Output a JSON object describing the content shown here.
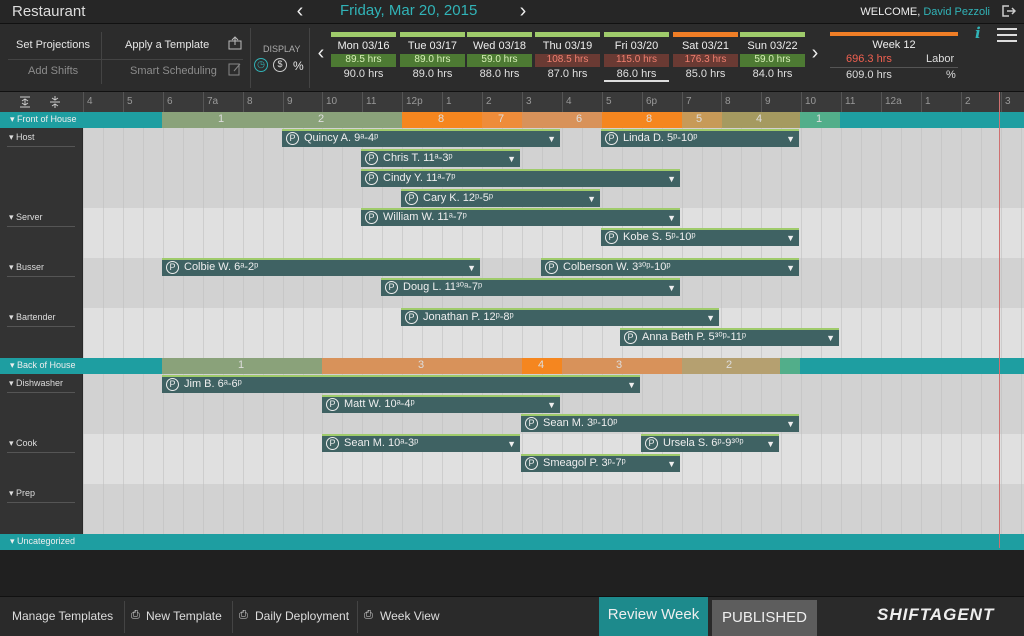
{
  "app_title": "Restaurant",
  "date_title": "Friday, Mar 20, 2015",
  "welcome": {
    "prefix": "WELCOME,",
    "user": "David Pezzoli"
  },
  "toolbar": {
    "set_projections": "Set Projections",
    "apply_template": "Apply a Template",
    "add_shifts": "Add Shifts",
    "smart_scheduling": "Smart Scheduling",
    "display_label": "DISPLAY",
    "percent_symbol": "%"
  },
  "days": [
    {
      "label": "Mon 03/16",
      "hours": "89.5 hrs",
      "scheduled": "90.0 hrs",
      "status": "ok"
    },
    {
      "label": "Tue 03/17",
      "hours": "89.0 hrs",
      "scheduled": "89.0 hrs",
      "status": "ok"
    },
    {
      "label": "Wed 03/18",
      "hours": "59.0 hrs",
      "scheduled": "88.0 hrs",
      "status": "ok"
    },
    {
      "label": "Thu 03/19",
      "hours": "108.5 hrs",
      "scheduled": "87.0 hrs",
      "status": "over"
    },
    {
      "label": "Fri 03/20",
      "hours": "115.0 hrs",
      "scheduled": "86.0 hrs",
      "status": "over"
    },
    {
      "label": "Sat 03/21",
      "hours": "176.3 hrs",
      "scheduled": "85.0 hrs",
      "status": "over"
    },
    {
      "label": "Sun 03/22",
      "hours": "59.0 hrs",
      "scheduled": "84.0 hrs",
      "status": "ok"
    }
  ],
  "week": {
    "label": "Week 12",
    "projected": "696.3 hrs",
    "scheduled": "609.0 hrs",
    "labor": "Labor",
    "labor_unit": "%"
  },
  "timeline_labels": [
    "4",
    "5",
    "6",
    "7a",
    "8",
    "9",
    "10",
    "11",
    "12p",
    "1",
    "2",
    "3",
    "4",
    "5",
    "6p",
    "7",
    "8",
    "9",
    "10",
    "11",
    "12a",
    "1",
    "2",
    "3"
  ],
  "groups": {
    "front": "Front of House",
    "back": "Back of House",
    "uncat": "Uncategorized"
  },
  "front_coverage": [
    "1",
    "2",
    "8",
    "7",
    "6",
    "8",
    "5",
    "4",
    "1"
  ],
  "back_coverage": [
    "1",
    "3",
    "4",
    "3",
    "2"
  ],
  "roles": {
    "host": "Host",
    "server": "Server",
    "busser": "Busser",
    "bartender": "Bartender",
    "dishwasher": "Dishwasher",
    "cook": "Cook",
    "prep": "Prep"
  },
  "shifts": {
    "quincy": "Quincy A. 9ᵃ-4ᵖ",
    "linda": "Linda D. 5ᵖ-10ᵖ",
    "chris": "Chris T. 11ᵃ-3ᵖ",
    "cindy": "Cindy Y. 11ᵃ-7ᵖ",
    "cary": "Cary K. 12ᵖ-5ᵖ",
    "william": "William W. 11ᵃ-7ᵖ",
    "kobe": "Kobe S. 5ᵖ-10ᵖ",
    "colbie": "Colbie W. 6ᵃ-2ᵖ",
    "colberson": "Colberson W. 3³⁰ᵖ-10ᵖ",
    "doug": "Doug L. 11³⁰ᵃ-7ᵖ",
    "jonathan": "Jonathan P. 12ᵖ-8ᵖ",
    "annabeth": "Anna Beth P. 5³⁰ᵖ-11ᵖ",
    "jim": "Jim B. 6ᵃ-6ᵖ",
    "matt": "Matt W. 10ᵃ-4ᵖ",
    "sean_m1": "Sean M. 3ᵖ-10ᵖ",
    "sean_m2": "Sean M. 10ᵃ-3ᵖ",
    "ursela": "Ursela S. 6ᵖ-9³⁰ᵖ",
    "smeagol": "Smeagol P. 3ᵖ-7ᵖ"
  },
  "footer": {
    "manage_templates": "Manage Templates",
    "new_template": "New Template",
    "daily_deployment": "Daily Deployment",
    "week_view": "Week View",
    "review_week": "Review Week",
    "published": "PUBLISHED",
    "logo": "SHIFTAGENT"
  },
  "colors": {
    "accent": "#31b3b7",
    "group_bar": "#1e9ea1",
    "shift": "#3f6263",
    "over": "#f06050",
    "ok": "#9fcb6b",
    "orange": "#f07e26"
  }
}
